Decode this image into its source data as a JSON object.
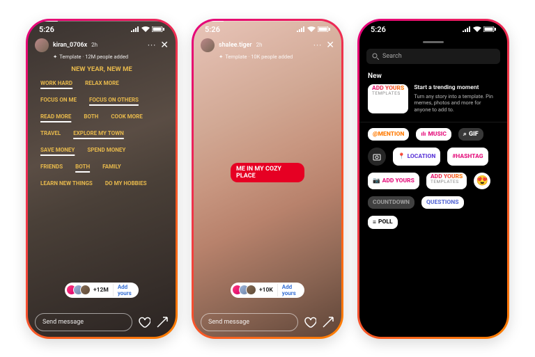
{
  "status": {
    "time": "5:26"
  },
  "story1": {
    "user": "kiran_0706x",
    "time": "2h",
    "template_line": "Template · 12M people added",
    "title": "NEW YEAR, NEW ME",
    "rows": [
      [
        {
          "t": "WORK HARD",
          "u": true
        },
        {
          "t": "RELAX MORE"
        }
      ],
      [
        {
          "t": "FOCUS ON ME"
        },
        {
          "t": "FOCUS ON OTHERS",
          "u": true
        }
      ],
      [
        {
          "t": "READ MORE",
          "u": true
        },
        {
          "t": "BOTH"
        },
        {
          "t": "COOK MORE"
        }
      ],
      [
        {
          "t": "TRAVEL"
        },
        {
          "t": "EXPLORE MY TOWN",
          "u": true
        }
      ],
      [
        {
          "t": "SAVE MONEY",
          "u": true
        },
        {
          "t": "SPEND MONEY"
        }
      ],
      [
        {
          "t": "FRIENDS"
        },
        {
          "t": "BOTH",
          "u": true
        },
        {
          "t": "FAMILY"
        }
      ],
      [
        {
          "t": "LEARN NEW THINGS"
        },
        {
          "t": "DO MY HOBBIES"
        }
      ]
    ],
    "pill": {
      "count": "+12M",
      "btn": "Add yours"
    }
  },
  "story2": {
    "user": "shalee.tiger",
    "time": "2h",
    "template_line": "Template · 10K people added",
    "label": "ME IN MY COZY PLACE",
    "pill": {
      "count": "+10K",
      "btn": "Add yours"
    }
  },
  "footer": {
    "placeholder": "Send message"
  },
  "sheet": {
    "search": "Search",
    "section": "New",
    "promo": {
      "chip_top": "ADD YOURS",
      "chip_sub": "TEMPLATES",
      "title": "Start a trending moment",
      "desc": "Turn any story into a template. Pin memes, photos and more for anyone to add to."
    },
    "stickers": {
      "mention": "@MENTION",
      "music": "MUSIC",
      "gif": "GIF",
      "location": "LOCATION",
      "hashtag": "#HASHTAG",
      "addyours": "ADD YOURS",
      "addyours_tpl_top": "ADD YOURS",
      "addyours_tpl_sub": "TEMPLATES",
      "countdown": "COUNTDOWN",
      "questions": "QUESTIONS",
      "poll": "POLL"
    }
  }
}
